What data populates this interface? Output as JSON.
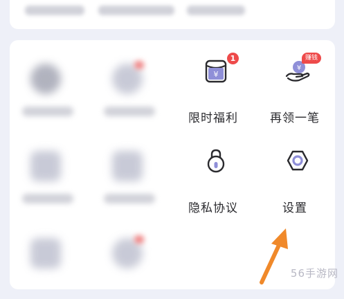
{
  "menu": {
    "limited_welfare": {
      "label": "限时福利",
      "badge": "1"
    },
    "claim_again": {
      "label": "再领一笔",
      "badge": "赚钱"
    },
    "privacy_policy": {
      "label": "隐私协议"
    },
    "settings": {
      "label": "设置"
    }
  },
  "watermark": "56手游网",
  "colors": {
    "accent": "#ee4a4a",
    "icon_stroke": "#2a2a2e",
    "arrow": "#f0892a"
  }
}
